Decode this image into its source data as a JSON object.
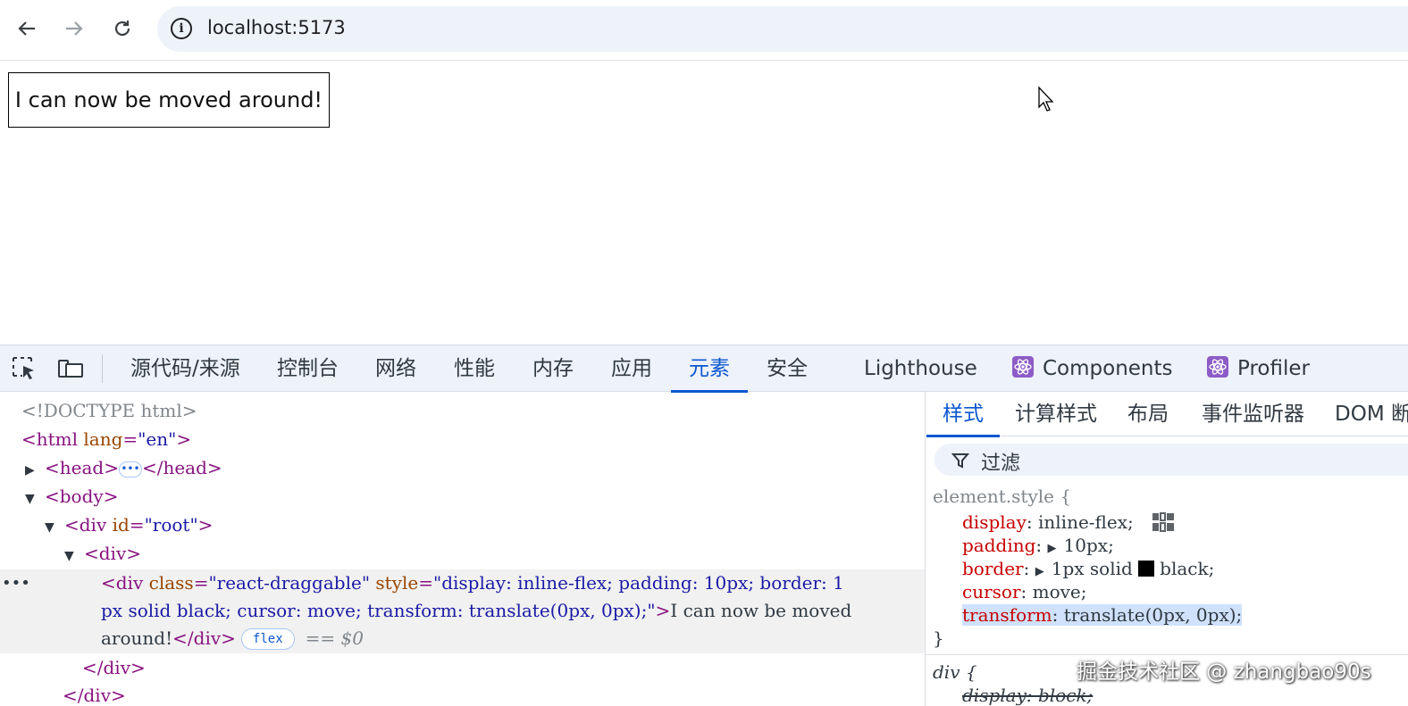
{
  "browser": {
    "back_icon": "arrow-left-icon",
    "forward_icon": "arrow-right-icon",
    "reload_icon": "reload-icon",
    "url": "localhost:5173"
  },
  "page": {
    "draggable_text": "I can now be moved around!"
  },
  "devtools": {
    "tabs": [
      "源代码/来源",
      "控制台",
      "网络",
      "性能",
      "内存",
      "应用",
      "元素",
      "安全",
      "Lighthouse",
      "Components",
      "Profiler"
    ],
    "active_tab": "元素",
    "elements": {
      "doctype": "<!DOCTYPE html>",
      "html_open": "<html ",
      "html_lang_attr": "lang",
      "html_lang_val": "\"en\"",
      "head_open": "<head>",
      "head_ellipsis": "•••",
      "head_close": "</head>",
      "body_open": "<body>",
      "root_open": "<div ",
      "root_attr": "id",
      "root_val": "\"root\"",
      "div_open": "<div>",
      "sel_open": "<div ",
      "sel_class_attr": "class",
      "sel_class_val": "\"react-draggable\"",
      "sel_style_attr": "style",
      "sel_style_val_1": "\"display: inline-flex; padding: 10px; border: 1",
      "sel_style_val_2": "px solid black; cursor: move; transform: translate(0px, 0px);\"",
      "sel_text_1": "I can now be moved",
      "sel_text_2": "around!",
      "sel_close": "</div>",
      "flex_badge": "flex",
      "dollar_ref": "== $0",
      "div_close": "</div>",
      "root_close": "</div>"
    },
    "styles": {
      "tabs": [
        "样式",
        "计算样式",
        "布局",
        "事件监听器",
        "DOM 断"
      ],
      "active_tab": "样式",
      "filter_label": "过滤",
      "element_style_selector": "element.style {",
      "props": [
        {
          "name": "display",
          "value": "inline-flex;"
        },
        {
          "name": "padding",
          "value": "10px;"
        },
        {
          "name": "border",
          "value": "1px solid",
          "value2": "black;"
        },
        {
          "name": "cursor",
          "value": "move;"
        },
        {
          "name": "transform",
          "value": "translate(0px, 0px);"
        }
      ],
      "close_brace": "}",
      "div_selector": "div {",
      "div_prop": "display",
      "div_value": "block;"
    }
  },
  "watermark": "掘金技术社区 @ zhangbao90s"
}
